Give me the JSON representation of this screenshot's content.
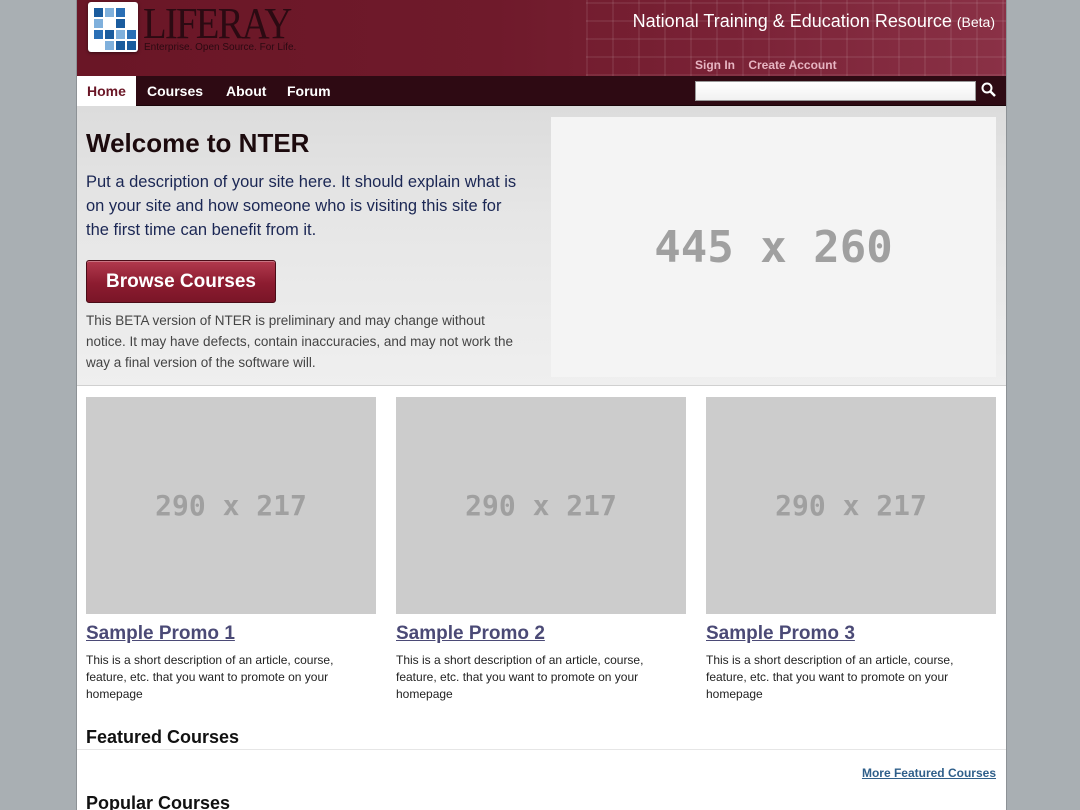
{
  "header": {
    "logo_text": "LIFERAY",
    "logo_tagline": "Enterprise. Open Source. For Life.",
    "site_title": "National Training & Education Resource",
    "site_title_suffix": "(Beta)",
    "sign_in": "Sign In",
    "create_account": "Create Account"
  },
  "nav": {
    "items": [
      {
        "label": "Home",
        "active": true
      },
      {
        "label": "Courses",
        "active": false
      },
      {
        "label": "About",
        "active": false
      },
      {
        "label": "Forum",
        "active": false
      }
    ],
    "search_value": "",
    "search_icon": "magnifier-icon"
  },
  "hero": {
    "title": "Welcome to NTER",
    "description": "Put a description of your site here. It should explain what is on your site and how someone who is visiting this site for the first time can benefit from it.",
    "button": "Browse Courses",
    "note": "This BETA version of NTER is preliminary and may change without notice. It may have defects, contain inaccuracies, and may not work the way a final version of the software will.",
    "placeholder": "445 x 260"
  },
  "promos": [
    {
      "image": "290 x 217",
      "title": "Sample Promo 1",
      "description": "This is a short description of an article, course, feature, etc. that you want to promote on your homepage"
    },
    {
      "image": "290 x 217",
      "title": "Sample Promo 2",
      "description": "This is a short description of an article, course, feature, etc. that you want to promote on your homepage"
    },
    {
      "image": "290 x 217",
      "title": "Sample Promo 3",
      "description": "This is a short description of an article, course, feature, etc. that you want to promote on your homepage"
    }
  ],
  "featured": {
    "heading": "Featured Courses",
    "more_link": "More Featured Courses"
  },
  "popular": {
    "heading": "Popular Courses"
  },
  "colors": {
    "brand": "#6a1626",
    "nav_bg": "#2e0a13",
    "link": "#4b4a76",
    "button": "#8c1c30"
  }
}
